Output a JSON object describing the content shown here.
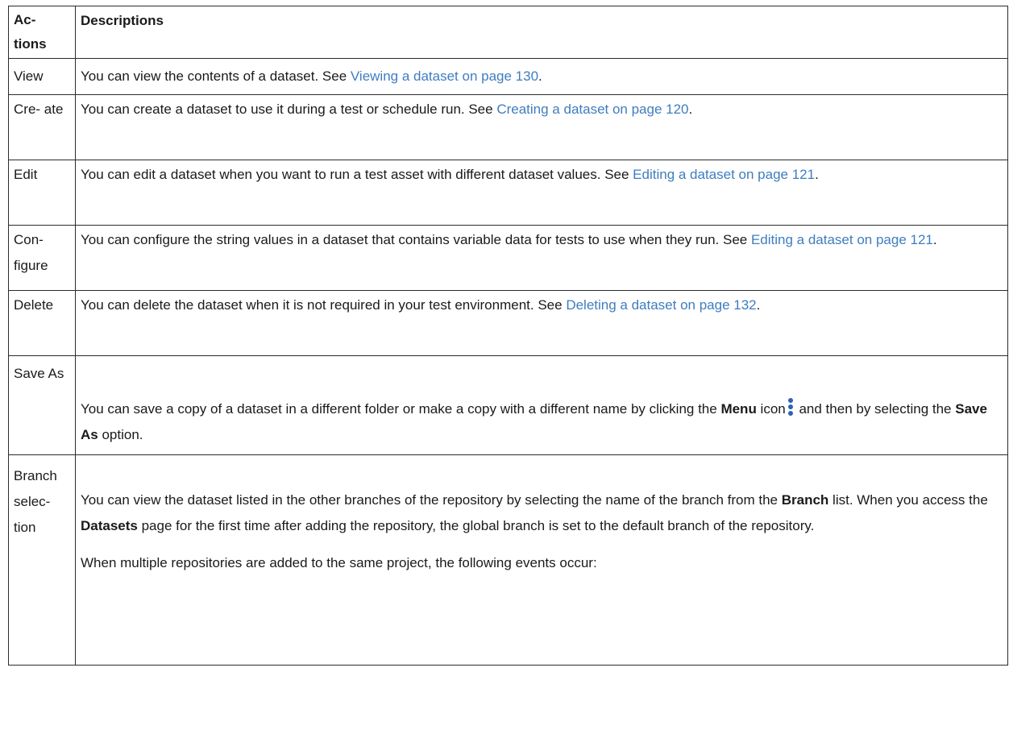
{
  "table": {
    "header": {
      "actions": "Ac- tions",
      "descriptions": "Descriptions"
    },
    "rows": {
      "view": {
        "action": "View",
        "text_1": "You can view the contents of a dataset. See ",
        "link": "Viewing a dataset on page 130",
        "text_2": "."
      },
      "create": {
        "action": "Cre- ate",
        "text_1": "You can create a dataset to use it during a test or schedule run. See ",
        "link": "Creating a dataset on page 120",
        "text_2": "."
      },
      "edit": {
        "action": "Edit",
        "text_1": "You can edit a dataset when you want to run a test asset with different dataset values. See ",
        "link": "Editing a dataset on page 121",
        "text_2": "."
      },
      "configure": {
        "action": "Con- figure",
        "text_1": "You can configure the string values in a dataset that contains variable data for tests to use when they run. See ",
        "link": "Editing a dataset on page 121",
        "text_2": "."
      },
      "delete": {
        "action": "Delete",
        "text_1": "You can delete the dataset when it is not required in your test environment. See ",
        "link": "Deleting a dataset on page 132",
        "text_2": "."
      },
      "save_as": {
        "action": "Save As",
        "text_1": "You can save a copy of a dataset in a different folder or make a copy with a different name by clicking the ",
        "bold_1": "Menu",
        "text_2": " icon",
        "icon": "vertical-ellipsis-menu-icon",
        "text_3": " and then by selecting the ",
        "bold_2": "Save As",
        "text_4": " option."
      },
      "branch": {
        "action": "Branch selec- tion",
        "text_1": "You can view the dataset listed in the other branches of the repository by selecting the name of the branch from the ",
        "bold_1": "Branch",
        "text_2": " list. When you access the ",
        "bold_2": "Datasets",
        "text_3": " page for the first time after adding the repository, the global branch is set to the default branch of the repository.",
        "para_2": "When multiple repositories are added to the same project, the following events occur:"
      }
    }
  },
  "colors": {
    "link": "#3f7dbf",
    "menu_icon": "#2f62b5",
    "text": "#1a1a1a",
    "border": "#2b2b2b"
  }
}
